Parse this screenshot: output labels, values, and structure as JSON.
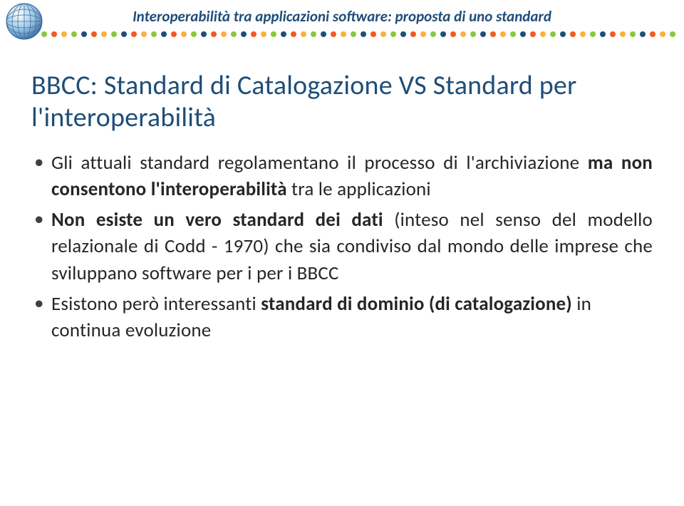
{
  "header": {
    "title": "Interoperabilità tra applicazioni software: proposta di uno standard"
  },
  "decor": {
    "dot_colors": [
      "#8cc63f",
      "#f15a24",
      "#fbb03b",
      "#8cc63f",
      "#1f4e79",
      "#f15a24",
      "#fbb03b",
      "#8cc63f",
      "#1f4e79",
      "#f15a24",
      "#fbb03b",
      "#8cc63f",
      "#1f4e79",
      "#f15a24",
      "#fbb03b",
      "#8cc63f",
      "#1f4e79",
      "#f15a24",
      "#fbb03b",
      "#8cc63f",
      "#1f4e79",
      "#f15a24",
      "#fbb03b",
      "#8cc63f",
      "#1f4e79",
      "#f15a24",
      "#fbb03b",
      "#8cc63f",
      "#1f4e79",
      "#f15a24",
      "#fbb03b",
      "#8cc63f",
      "#1f4e79",
      "#f15a24",
      "#fbb03b",
      "#8cc63f",
      "#1f4e79",
      "#f15a24",
      "#fbb03b",
      "#8cc63f",
      "#1f4e79",
      "#f15a24",
      "#fbb03b",
      "#8cc63f",
      "#1f4e79",
      "#f15a24",
      "#fbb03b",
      "#8cc63f",
      "#1f4e79",
      "#f15a24",
      "#fbb03b",
      "#8cc63f",
      "#1f4e79",
      "#f15a24",
      "#fbb03b",
      "#8cc63f",
      "#1f4e79",
      "#f15a24",
      "#fbb03b",
      "#8cc63f",
      "#1f4e79",
      "#f15a24",
      "#fbb03b",
      "#8cc63f"
    ]
  },
  "slide": {
    "title": "BBCC: Standard di Catalogazione VS Standard per l'interoperabilità"
  },
  "bullets": [
    {
      "pre": "Gli attuali standard regolamentano il processo di l'archiviazione ",
      "bold": "ma non consentono l'interoperabilità",
      "post": " tra le applicazioni",
      "justify": true
    },
    {
      "pre": "",
      "bold": "Non esiste un vero standard dei dati",
      "post": " (inteso nel senso del modello relazionale di Codd - 1970) che sia condiviso dal mondo delle imprese che sviluppano software per i per i BBCC",
      "justify": true
    },
    {
      "pre": "Esistono però interessanti ",
      "bold": "standard di dominio (di catalogazione)",
      "post": " in continua evoluzione",
      "justify": false
    }
  ]
}
